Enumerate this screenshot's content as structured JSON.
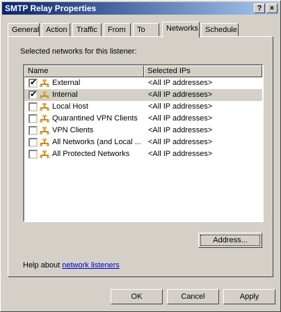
{
  "window": {
    "title": "SMTP Relay Properties",
    "help_btn": "?",
    "close_btn": "×"
  },
  "tabs": [
    "General",
    "Action",
    "Traffic",
    "From",
    "To",
    "Networks",
    "Schedule"
  ],
  "active_tab": "Networks",
  "section_label": "Selected networks for this listener:",
  "table": {
    "headers": [
      "Name",
      "Selected IPs"
    ],
    "rows": [
      {
        "name": "External",
        "ips": "<All IP addresses>",
        "checked": true
      },
      {
        "name": "Internal",
        "ips": "<All IP addresses>",
        "checked": true
      },
      {
        "name": "Local Host",
        "ips": "<All IP addresses>",
        "checked": false
      },
      {
        "name": "Quarantined VPN Clients",
        "ips": "<All IP addresses>",
        "checked": false
      },
      {
        "name": "VPN Clients",
        "ips": "<All IP addresses>",
        "checked": false
      },
      {
        "name": "All Networks (and Local ...",
        "ips": "<All IP addresses>",
        "checked": false
      },
      {
        "name": "All Protected Networks",
        "ips": "<All IP addresses>",
        "checked": false
      }
    ]
  },
  "address_button": "Address...",
  "help": {
    "prefix": "Help about ",
    "link": "network listeners"
  },
  "buttons": {
    "ok": "OK",
    "cancel": "Cancel",
    "apply": "Apply"
  }
}
